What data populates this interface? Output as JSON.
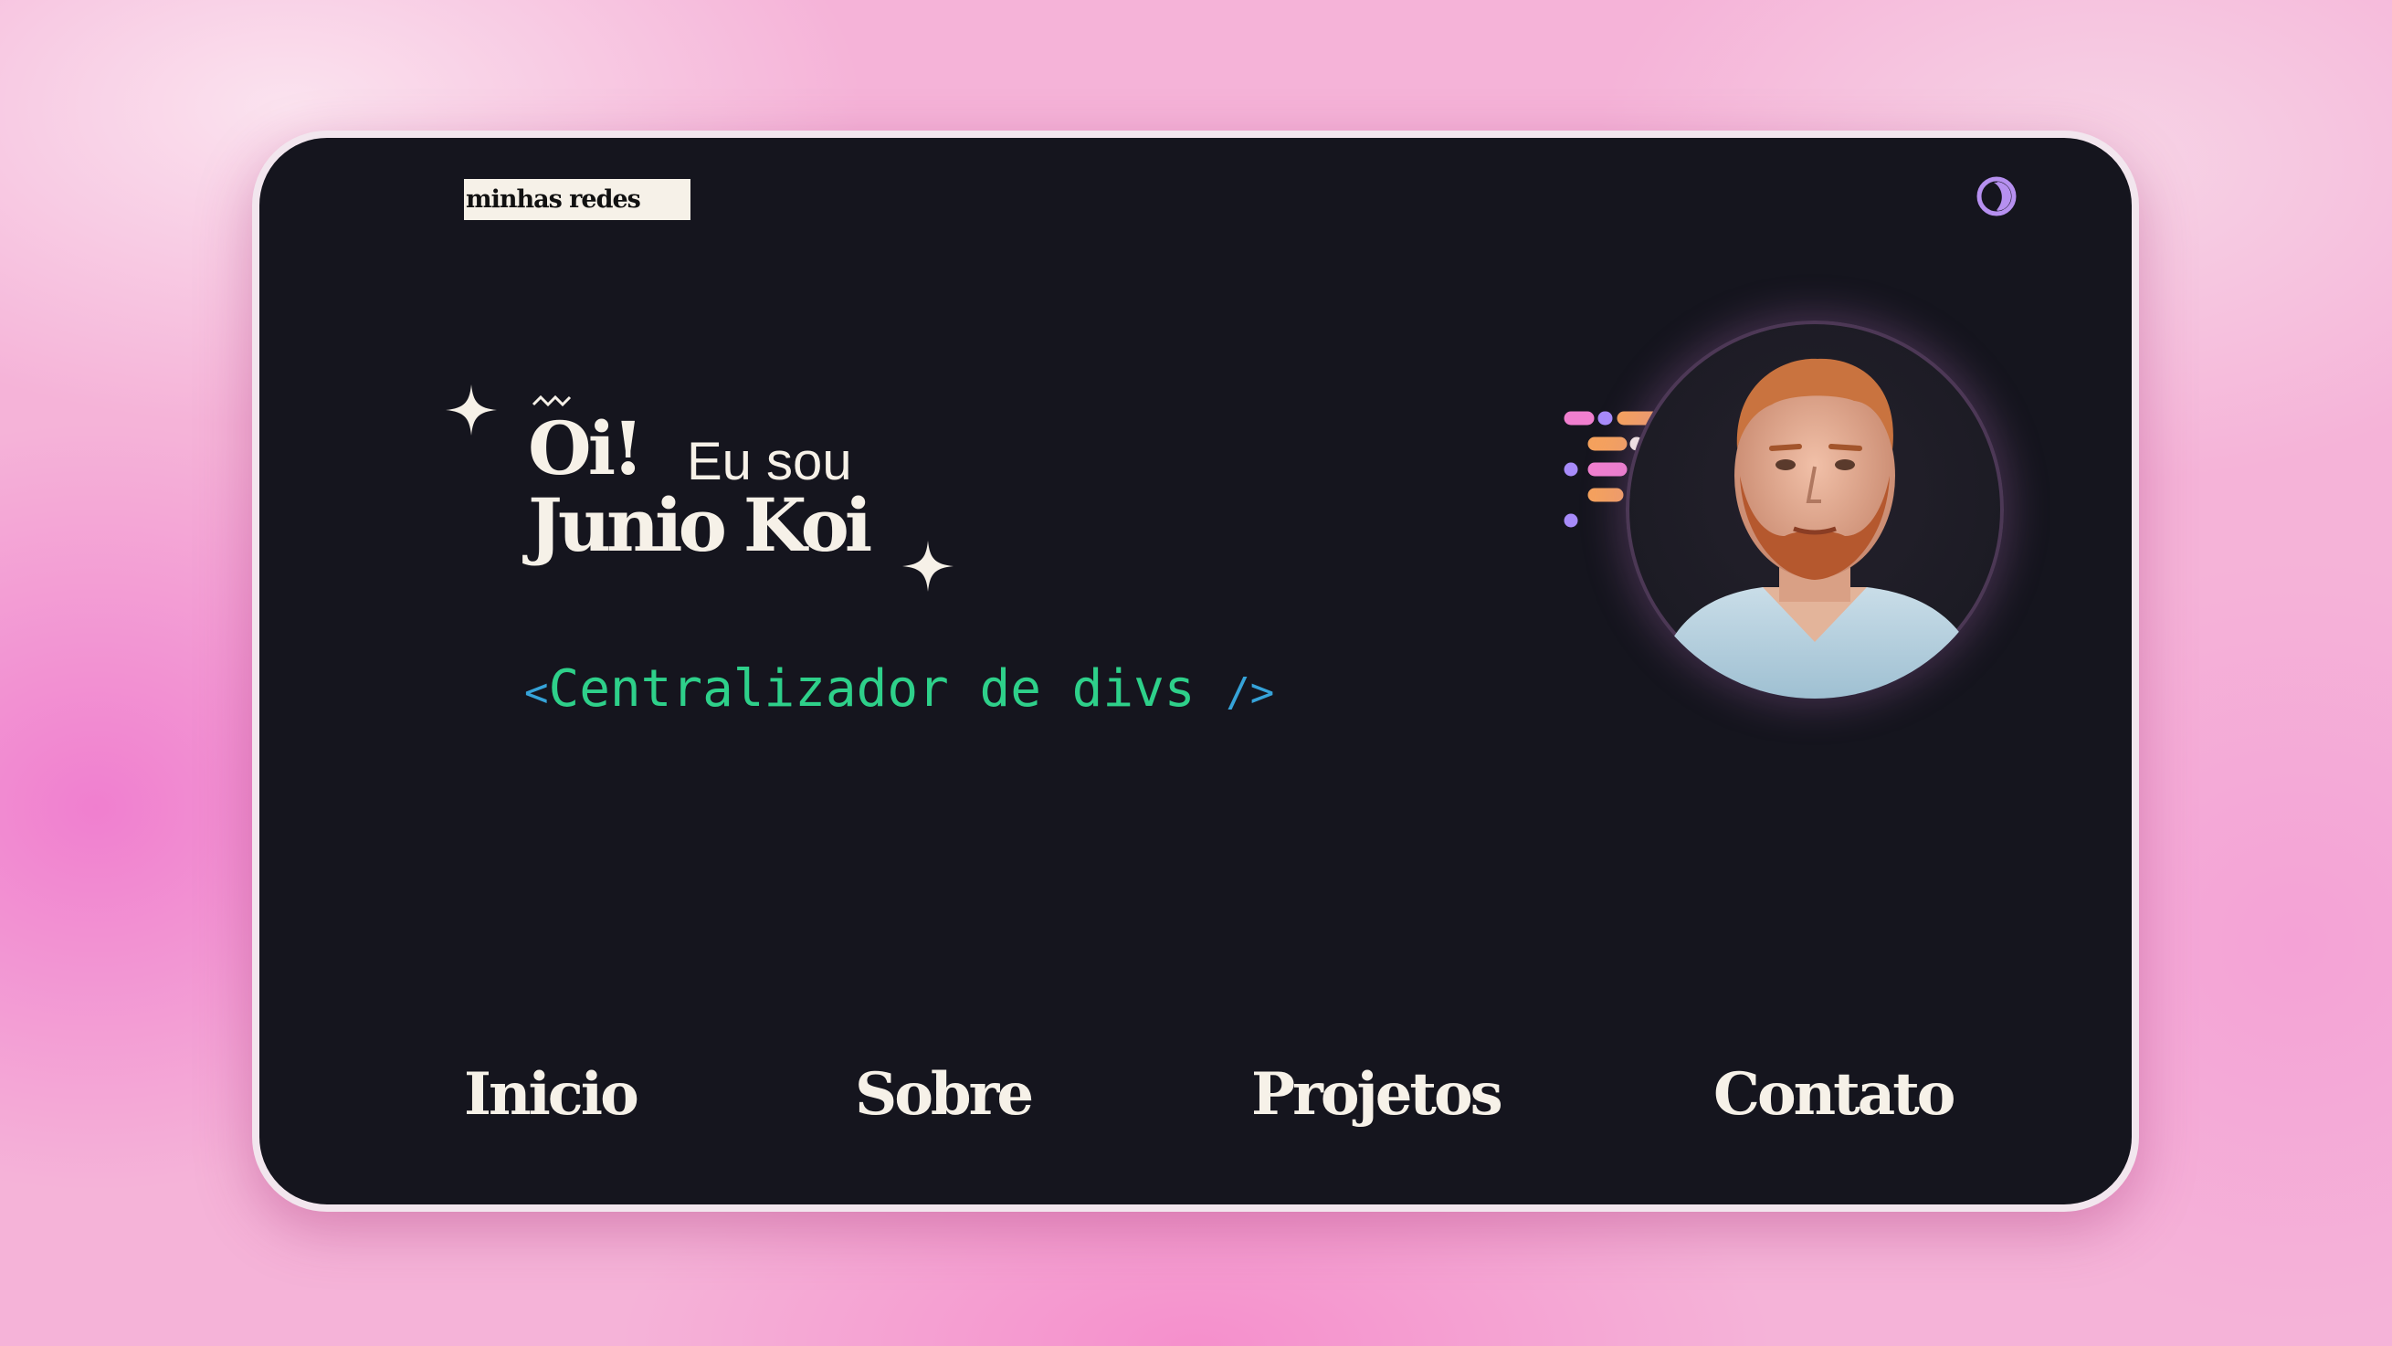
{
  "header": {
    "socials_label": "minhas redes",
    "theme_toggle_icon": "half-moon-icon"
  },
  "hero": {
    "greeting": "Oi!",
    "intro": "Eu sou",
    "name": "Junio Koi",
    "role_open": "<",
    "role_text": "Centralizador de divs",
    "role_close": "/>"
  },
  "nav": {
    "items": [
      {
        "label": "Inicio"
      },
      {
        "label": "Sobre"
      },
      {
        "label": "Projetos"
      },
      {
        "label": "Contato"
      }
    ]
  },
  "colors": {
    "card_bg": "#15151e",
    "text": "#f6f1e8",
    "accent_green": "#2ed08a",
    "accent_blue": "#36a3d9",
    "toggle": "#b690f0",
    "code_pink": "#f07fcf",
    "code_orange": "#f5a25d",
    "code_purple": "#a78bfa",
    "code_green": "#4ade80",
    "code_yellow": "#fde047"
  }
}
